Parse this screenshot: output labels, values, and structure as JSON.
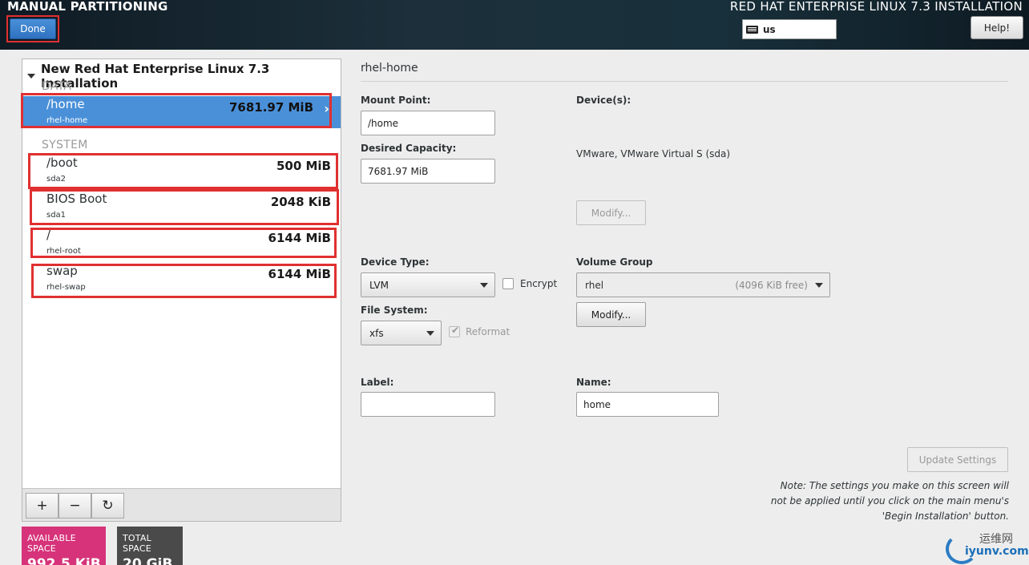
{
  "header": {
    "left_title": "MANUAL PARTITIONING",
    "right_title": "RED HAT ENTERPRISE LINUX 7.3 INSTALLATION",
    "done_label": "Done",
    "keyboard_layout": "us",
    "help_label": "Help!"
  },
  "tree": {
    "title": "New Red Hat Enterprise Linux 7.3 Installation",
    "data_section": "DATA",
    "system_section": "SYSTEM",
    "data_items": [
      {
        "name": "/home",
        "sub": "rhel-home",
        "size": "7681.97 MiB"
      }
    ],
    "system_items": [
      {
        "name": "/boot",
        "sub": "sda2",
        "size": "500 MiB"
      },
      {
        "name": "BIOS Boot",
        "sub": "sda1",
        "size": "2048 KiB"
      },
      {
        "name": "/",
        "sub": "rhel-root",
        "size": "6144 MiB"
      },
      {
        "name": "swap",
        "sub": "rhel-swap",
        "size": "6144 MiB"
      }
    ],
    "add_symbol": "+",
    "remove_symbol": "−",
    "refresh_symbol": "↻"
  },
  "space": {
    "available_label": "AVAILABLE SPACE",
    "available_value": "992.5 KiB",
    "total_label": "TOTAL SPACE",
    "total_value": "20 GiB"
  },
  "detail": {
    "title": "rhel-home",
    "mount_point_label": "Mount Point:",
    "mount_point_value": "/home",
    "desired_capacity_label": "Desired Capacity:",
    "desired_capacity_value": "7681.97 MiB",
    "devices_label": "Device(s):",
    "devices_value": "VMware, VMware Virtual S (sda)",
    "modify_label": "Modify...",
    "device_type_label": "Device Type:",
    "device_type_value": "LVM",
    "encrypt_label": "Encrypt",
    "volume_group_label": "Volume Group",
    "volume_group_value": "rhel",
    "volume_group_free": "(4096 KiB free)",
    "file_system_label": "File System:",
    "file_system_value": "xfs",
    "reformat_label": "Reformat",
    "label_label": "Label:",
    "label_value": "",
    "name_label": "Name:",
    "name_value": "home",
    "update_label": "Update Settings",
    "note": "Note:  The settings you make on this screen will not be applied until you click on the main menu's 'Begin Installation' button."
  },
  "watermark": {
    "cn": "运维网",
    "url": "iyunv.com"
  },
  "colors": {
    "selected_row": "#4a90d9",
    "highlight_border": "#e03030",
    "available_space": "#d6337a",
    "total_space": "#4a4a4a"
  }
}
